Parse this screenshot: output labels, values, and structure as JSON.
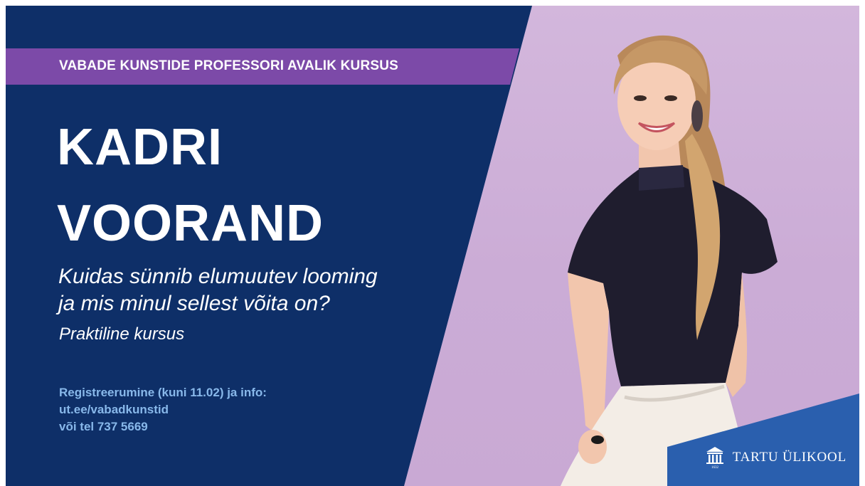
{
  "banner": {
    "eyebrow": "VABADE KUNSTIDE PROFESSORI AVALIK KURSUS",
    "name_line1": "KADRI",
    "name_line2": "VOORAND",
    "question_line1": "Kuidas sünnib elumuutev looming",
    "question_line2": "ja mis minul sellest võita on?",
    "subtitle": "Praktiline kursus",
    "info": [
      "Registreerumine (kuni 11.02) ja info:",
      "ut.ee/vabadkunstid",
      "või tel 737 5669"
    ],
    "logo_text": "TARTU ÜLIKOOL",
    "logo_year": "1632"
  },
  "colors": {
    "navy": "#0e2f68",
    "purple_bar": "#7c4aa8",
    "lilac_background": "#cfb2d8",
    "info_text": "#88b8ea",
    "logo_corner": "#2a5fae"
  },
  "icons": {
    "logo": "university-building-icon"
  }
}
